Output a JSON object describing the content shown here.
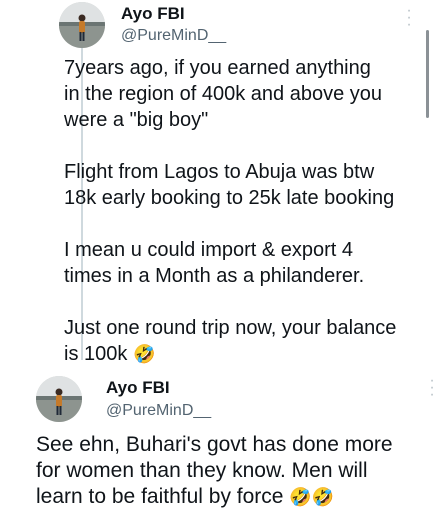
{
  "tweets": [
    {
      "author_name": "Ayo FBI",
      "author_handle": "@PureMinD__",
      "lines": [
        "7years ago, if you earned anything",
        "in the region of 400k and above you",
        "were a \"big boy\"",
        "Flight from Lagos to Abuja was btw",
        "18k early booking to 25k late booking",
        "I mean u could import & export 4",
        "times in a Month as a philanderer.",
        "Just one round trip now, your balance",
        "is 100k"
      ],
      "emoji_trail": "🤣"
    },
    {
      "author_name": "Ayo FBI",
      "author_handle": "@PureMinD__",
      "lines": [
        "See ehn, Buhari's govt has done more",
        "for women than they know. Men will",
        "learn to be faithful by force"
      ],
      "emoji_trail": "🤣🤣"
    }
  ],
  "icons": {
    "more_options": "more-vertical-icon",
    "avatar": "user-avatar-photo"
  }
}
